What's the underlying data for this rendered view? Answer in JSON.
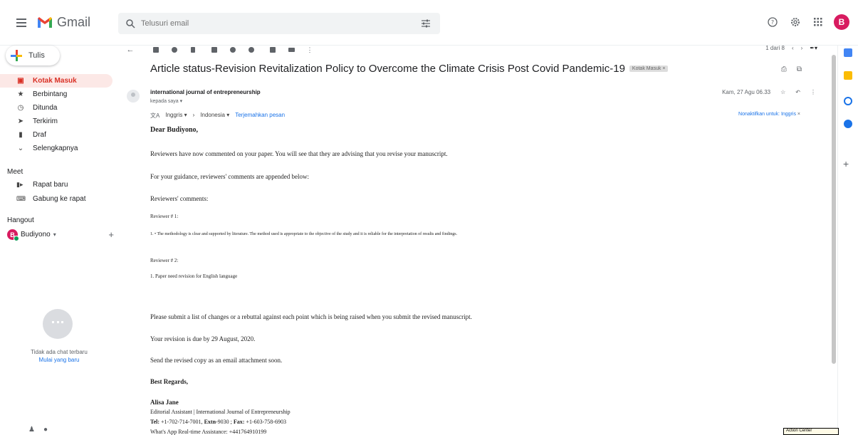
{
  "header": {
    "app_name": "Gmail",
    "search_placeholder": "Telusuri email",
    "avatar_letter": "B"
  },
  "sidebar": {
    "compose_label": "Tulis",
    "items": [
      {
        "label": "Kotak Masuk",
        "icon": "inbox-icon",
        "active": true
      },
      {
        "label": "Berbintang",
        "icon": "star-icon"
      },
      {
        "label": "Ditunda",
        "icon": "clock-icon"
      },
      {
        "label": "Terkirim",
        "icon": "send-icon"
      },
      {
        "label": "Draf",
        "icon": "draft-icon"
      },
      {
        "label": "Selengkapnya",
        "icon": "chevron-down-icon"
      }
    ],
    "meet": {
      "heading": "Meet",
      "new_meeting": "Rapat baru",
      "join_meeting": "Gabung ke rapat"
    },
    "hangout": {
      "heading": "Hangout",
      "user": "Budiyono",
      "user_initial": "B",
      "no_chat": "Tidak ada chat terbaru",
      "start_new": "Mulai yang baru"
    }
  },
  "toolbar": {
    "pager_text": "1 dari 8"
  },
  "email": {
    "subject": "Article status-Revision Revitalization Policy to Overcome the Climate Crisis Post Covid Pandemic-19",
    "label": "Kotak Masuk",
    "sender": "international journal of entrepreneurship",
    "to": "kepada saya",
    "date": "Kam, 27 Agu 06.33",
    "translate": {
      "from": "Inggris",
      "to": "Indonesia",
      "translate_link": "Terjemahkan pesan",
      "disable": "Nonaktifkan untuk: Inggris"
    },
    "body": {
      "greeting": "Dear Budiyono,",
      "p1": "Reviewers have now commented on your paper. You will see that they are advising that you revise your manuscript.",
      "p2": "For your guidance, reviewers' comments are appended below:",
      "p3": "Reviewers' comments:",
      "r1_head": "Reviewer # 1:",
      "r1_text": "1. • The methodology is clear and supported by literature. The method used is appropriate to the objective of the study and it is reliable for the interpretation of results and findings.",
      "r2_head": "Reviewer # 2:",
      "r2_text": "1. Paper need revision for English language",
      "p4": "Please submit a list of changes or a rebuttal against each point which is being raised when you submit the revised manuscript.",
      "p5": "Your revision is due by 29 August, 2020.",
      "p6": "Send the revised copy as an email attachment soon.",
      "regards": "Best Regards,",
      "sig_name": "Alisa Jane",
      "sig_role": "Editorial Assistant |  International Journal of Entrepreneurship",
      "tel_label": "Tel:",
      "tel": "+1-702-714-7001,",
      "extn_label": "Extn",
      "extn": "-9030 ;",
      "fax_label": "Fax:",
      "fax": "+1-603-758-6903",
      "whatsapp": "What's App Real-time Assistance: +441764910199"
    }
  },
  "taskbar": {
    "action_center": "Action Center"
  },
  "colors": {
    "accent_red": "#d93025",
    "active_bg": "#fce8e6",
    "link_blue": "#1a73e8",
    "avatar_pink": "#d81b60"
  }
}
